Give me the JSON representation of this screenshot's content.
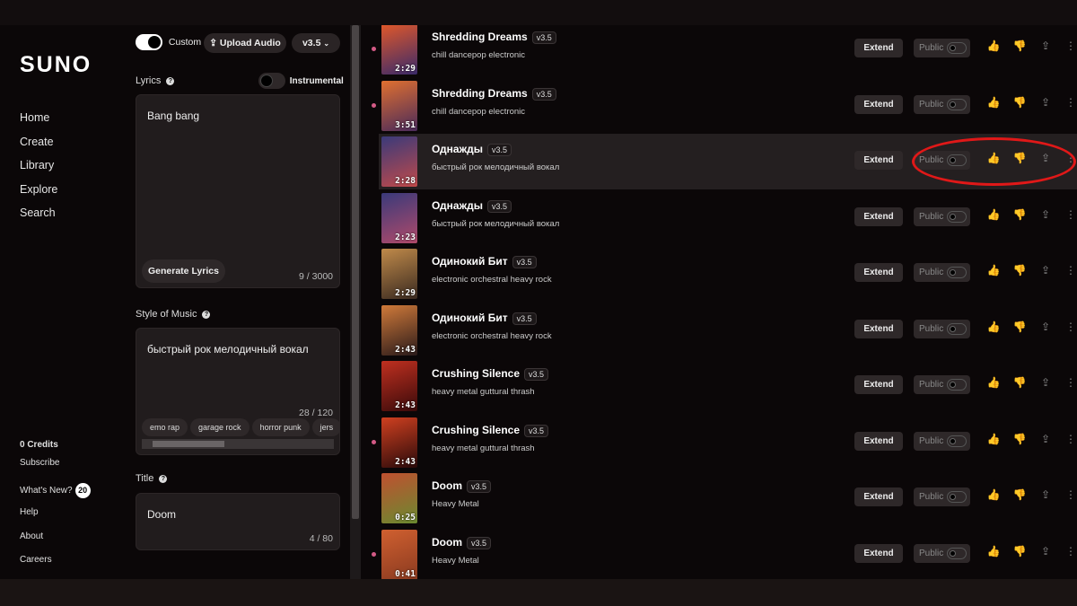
{
  "sidebar": {
    "logo": "SUNO",
    "nav": [
      "Home",
      "Create",
      "Library",
      "Explore",
      "Search"
    ],
    "credits": "0 Credits",
    "subscribe": "Subscribe",
    "whats_new": "What's New?",
    "whats_new_count": "20",
    "help": "Help",
    "about": "About",
    "careers": "Careers"
  },
  "create": {
    "custom_label": "Custom",
    "upload_label": "Upload Audio",
    "version": "v3.5",
    "lyrics_label": "Lyrics",
    "instrumental_label": "Instrumental",
    "lyrics_value": "Bang bang",
    "generate_lyrics": "Generate Lyrics",
    "lyrics_count": "9 / 3000",
    "style_label": "Style of Music",
    "style_value": "быстрый рок мелодичный вокал",
    "style_count": "28 / 120",
    "style_tags": [
      "emo rap",
      "garage rock",
      "horror punk",
      "jers"
    ],
    "title_label": "Title",
    "title_value": "Doom",
    "title_count": "4 / 80"
  },
  "list": {
    "extend_label": "Extend",
    "public_label": "Public",
    "accent": "#d45a86",
    "songs": [
      {
        "title": "Shredding Dreams",
        "version": "v3.5",
        "style": "chill dancepop electronic",
        "duration": "2:29",
        "new": true,
        "colors": [
          "#e0582a",
          "#3a2a6a"
        ]
      },
      {
        "title": "Shredding Dreams",
        "version": "v3.5",
        "style": "chill dancepop electronic",
        "duration": "3:51",
        "new": true,
        "colors": [
          "#e07030",
          "#4a2a5a"
        ]
      },
      {
        "title": "Однажды",
        "version": "v3.5",
        "style": "быстрый рок мелодичный вокал",
        "duration": "2:28",
        "new": false,
        "colors": [
          "#3a3a7a",
          "#c04a4a"
        ]
      },
      {
        "title": "Однажды",
        "version": "v3.5",
        "style": "быстрый рок мелодичный вокал",
        "duration": "2:23",
        "new": false,
        "colors": [
          "#3a3a7a",
          "#b04a6a"
        ]
      },
      {
        "title": "Одинокий Бит",
        "version": "v3.5",
        "style": "electronic orchestral heavy rock",
        "duration": "2:29",
        "new": false,
        "colors": [
          "#c08a4a",
          "#3a2a20"
        ]
      },
      {
        "title": "Одинокий Бит",
        "version": "v3.5",
        "style": "electronic orchestral heavy rock",
        "duration": "2:43",
        "new": false,
        "colors": [
          "#d07a3a",
          "#2a1a1a"
        ]
      },
      {
        "title": "Crushing Silence",
        "version": "v3.5",
        "style": "heavy metal guttural thrash",
        "duration": "2:43",
        "new": false,
        "colors": [
          "#c03020",
          "#3a0a0a"
        ]
      },
      {
        "title": "Crushing Silence",
        "version": "v3.5",
        "style": "heavy metal guttural thrash",
        "duration": "2:43",
        "new": true,
        "colors": [
          "#d04020",
          "#2a0a0a"
        ]
      },
      {
        "title": "Doom",
        "version": "v3.5",
        "style": "Heavy Metal",
        "duration": "0:25",
        "new": false,
        "colors": [
          "#c05030",
          "#6a8a30"
        ]
      },
      {
        "title": "Doom",
        "version": "v3.5",
        "style": "Heavy Metal",
        "duration": "0:41",
        "new": true,
        "colors": [
          "#d06030",
          "#8a3a20"
        ]
      }
    ]
  }
}
